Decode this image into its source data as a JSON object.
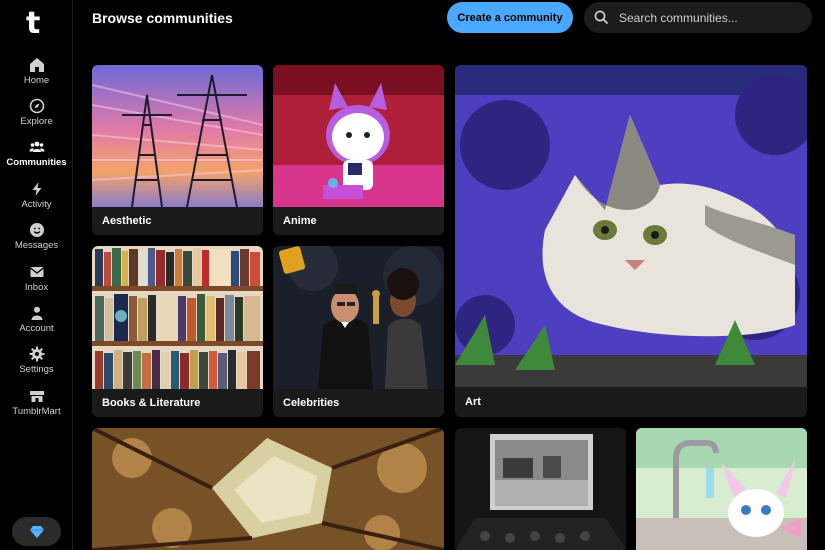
{
  "app": {
    "logo": "t"
  },
  "sidebar": {
    "items": [
      {
        "label": "Home",
        "icon": "home-icon"
      },
      {
        "label": "Explore",
        "icon": "compass-icon"
      },
      {
        "label": "Communities",
        "icon": "people-icon",
        "active": true
      },
      {
        "label": "Activity",
        "icon": "lightning-icon"
      },
      {
        "label": "Messages",
        "icon": "smiley-icon"
      },
      {
        "label": "Inbox",
        "icon": "envelope-icon"
      },
      {
        "label": "Account",
        "icon": "person-icon"
      },
      {
        "label": "Settings",
        "icon": "gear-icon"
      },
      {
        "label": "TumblrMart",
        "icon": "shop-icon"
      }
    ],
    "premium_icon": "diamond-icon"
  },
  "header": {
    "title": "Browse communities",
    "create_label": "Create a community",
    "search_placeholder": "Search communities..."
  },
  "communities": [
    {
      "name": "Aesthetic"
    },
    {
      "name": "Anime"
    },
    {
      "name": "Art"
    },
    {
      "name": "Books & Literature"
    },
    {
      "name": "Celebrities"
    }
  ],
  "colors": {
    "accent": "#4aa8ff",
    "background": "#000000",
    "card": "#1a1a1a"
  }
}
